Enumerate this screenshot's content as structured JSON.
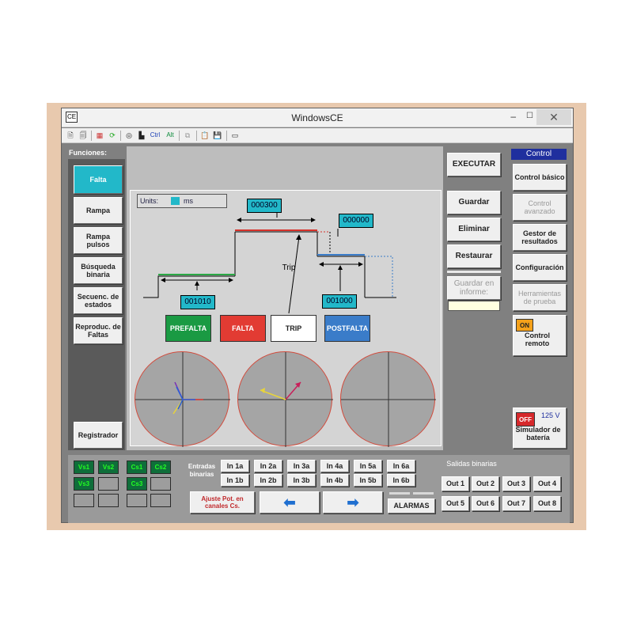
{
  "window": {
    "title": "WindowsCE"
  },
  "toolbar": {
    "icons": [
      "new-doc",
      "open-doc",
      "grid",
      "refresh",
      "view",
      "record",
      "ctrl",
      "alt",
      "copy",
      "paste",
      "save",
      "rect"
    ],
    "ctrl_label": "Ctrl",
    "alt_label": "Alt"
  },
  "functions": {
    "header": "Funciones:",
    "items": [
      "Falta",
      "Rampa",
      "Rampa pulsos",
      "Búsqueda binaria",
      "Secuenc. de estados",
      "Reproduc. de Faltas"
    ],
    "recorder": "Registrador"
  },
  "diagram": {
    "units_label": "Units:",
    "units_value": "ms",
    "time_prefault": "001010",
    "time_fault": "000300",
    "time_trip": "000000",
    "time_postfault": "001000",
    "trip_label": "Trip",
    "states": [
      {
        "label": "PREFALTA",
        "color": "#1a9a43",
        "text": "#ffffff"
      },
      {
        "label": "FALTA",
        "color": "#e23b33",
        "text": "#ffffff"
      },
      {
        "label": "TRIP",
        "color": "#ffffff",
        "text": "#222222"
      },
      {
        "label": "POSTFALTA",
        "color": "#3a7cc9",
        "text": "#ffffff"
      }
    ]
  },
  "actions": {
    "execute": "EXECUTAR",
    "save": "Guardar",
    "delete": "Eliminar",
    "restore": "Restaurar",
    "save_report": "Guardar en informe:"
  },
  "control": {
    "header": "Control",
    "basic": "Control básico",
    "advanced": "Control avanzado",
    "results": "Gestor de resultados",
    "config": "Configuración",
    "tools": "Herramientas de prueba",
    "remote_toggle": "ON",
    "remote": "Control remoto",
    "battery_toggle": "OFF",
    "battery_voltage": "125 V",
    "battery": "Simulador de batería"
  },
  "leds": {
    "row1": [
      "Vs1",
      "Vs2",
      "Cs1",
      "Cs2"
    ],
    "row2": [
      "Vs3",
      "",
      "Cs3",
      ""
    ]
  },
  "binary_inputs": {
    "label": "Entradas binarias",
    "row1": [
      "In 1a",
      "In 2a",
      "In 3a",
      "In 4a",
      "In 5a",
      "In 6a"
    ],
    "row2": [
      "In 1b",
      "In 2b",
      "In 3b",
      "In 4b",
      "In 5b",
      "In 6b"
    ]
  },
  "binary_outputs": {
    "label": "Salidas binarias",
    "row1": [
      "Out 1",
      "Out 2",
      "Out 3",
      "Out 4"
    ],
    "row2": [
      "Out 5",
      "Out 6",
      "Out 7",
      "Out 8"
    ]
  },
  "bottom": {
    "adjust": "Ajuste Pot. en canales Cs.",
    "alarms": "ALARMAS"
  },
  "colors": {
    "accent": "#22b8c9",
    "control_header": "#1f2f9e",
    "toggle_on": "#f5a11a",
    "toggle_off": "#d6282b"
  }
}
